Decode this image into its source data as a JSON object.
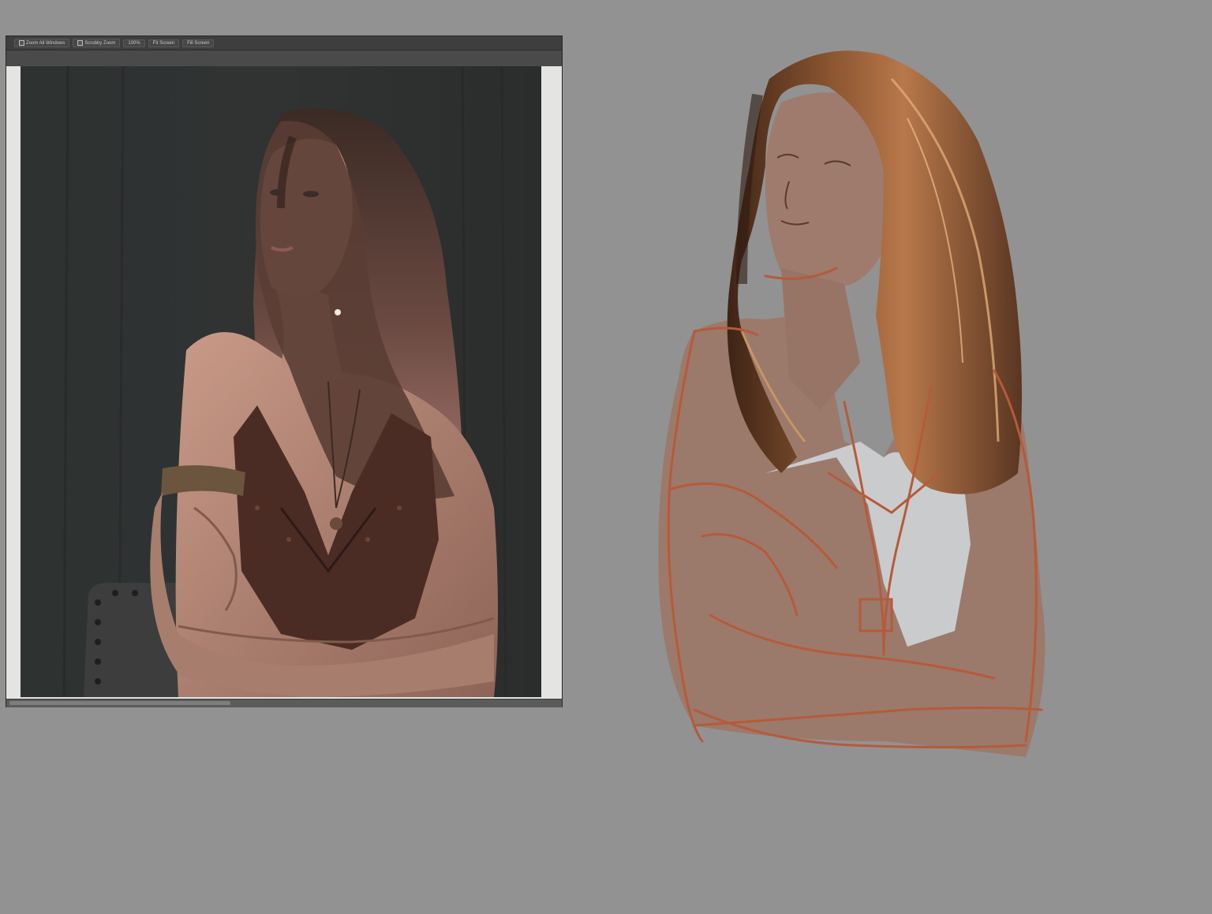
{
  "options_bar": {
    "zoom_all_windows": "Zoom All Windows",
    "scrubby_zoom": "Scrubby Zoom",
    "zoom_100": "100%",
    "fit_screen": "Fit Screen",
    "fill_screen": "Fill Screen"
  },
  "colors": {
    "workspace": "#929292",
    "photo_background": "#2d2f2f",
    "sketch_line": "#b65a3a",
    "skin_base": "#9b7a6c",
    "hair_dark": "#4a2f1f",
    "hair_light": "#c8915f"
  }
}
